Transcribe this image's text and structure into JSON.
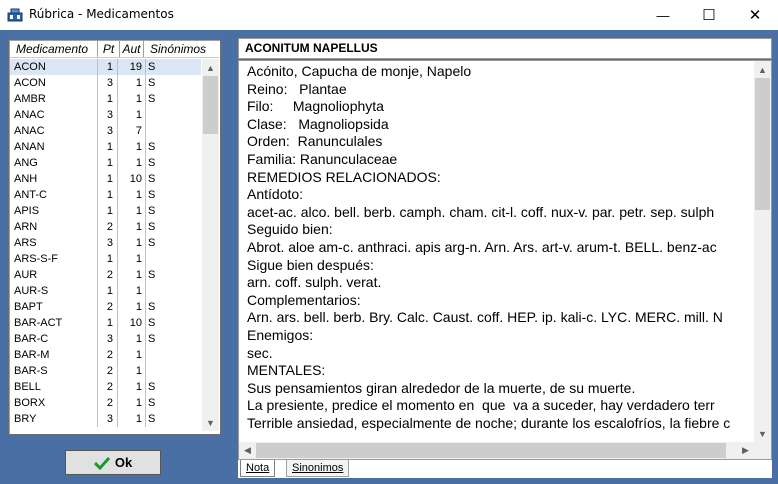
{
  "window": {
    "title": "Rúbrica - Medicamentos",
    "minimize_glyph": "—",
    "maximize_glyph": "☐",
    "close_glyph": "✕"
  },
  "list": {
    "headers": {
      "medicamento": "Medicamento",
      "pt": "Pt",
      "aut": "Aut",
      "sinonimos": "Sinónimos"
    },
    "rows": [
      {
        "med": "ACON",
        "pt": "1",
        "aut": "19",
        "sin": "S"
      },
      {
        "med": "ACON",
        "pt": "3",
        "aut": "1",
        "sin": "S"
      },
      {
        "med": "AMBR",
        "pt": "1",
        "aut": "1",
        "sin": "S"
      },
      {
        "med": "ANAC",
        "pt": "3",
        "aut": "1",
        "sin": ""
      },
      {
        "med": "ANAC",
        "pt": "3",
        "aut": "7",
        "sin": ""
      },
      {
        "med": "ANAN",
        "pt": "1",
        "aut": "1",
        "sin": "S"
      },
      {
        "med": "ANG",
        "pt": "1",
        "aut": "1",
        "sin": "S"
      },
      {
        "med": "ANH",
        "pt": "1",
        "aut": "10",
        "sin": "S"
      },
      {
        "med": "ANT-C",
        "pt": "1",
        "aut": "1",
        "sin": "S"
      },
      {
        "med": "APIS",
        "pt": "1",
        "aut": "1",
        "sin": "S"
      },
      {
        "med": "ARN",
        "pt": "2",
        "aut": "1",
        "sin": "S"
      },
      {
        "med": "ARS",
        "pt": "3",
        "aut": "1",
        "sin": "S"
      },
      {
        "med": "ARS-S-F",
        "pt": "1",
        "aut": "1",
        "sin": ""
      },
      {
        "med": "AUR",
        "pt": "2",
        "aut": "1",
        "sin": "S"
      },
      {
        "med": "AUR-S",
        "pt": "1",
        "aut": "1",
        "sin": ""
      },
      {
        "med": "BAPT",
        "pt": "2",
        "aut": "1",
        "sin": "S"
      },
      {
        "med": "BAR-ACT",
        "pt": "1",
        "aut": "10",
        "sin": "S"
      },
      {
        "med": "BAR-C",
        "pt": "3",
        "aut": "1",
        "sin": "S"
      },
      {
        "med": "BAR-M",
        "pt": "2",
        "aut": "1",
        "sin": ""
      },
      {
        "med": "BAR-S",
        "pt": "2",
        "aut": "1",
        "sin": ""
      },
      {
        "med": "BELL",
        "pt": "2",
        "aut": "1",
        "sin": "S"
      },
      {
        "med": "BORX",
        "pt": "2",
        "aut": "1",
        "sin": "S"
      },
      {
        "med": "BRY",
        "pt": "3",
        "aut": "1",
        "sin": "S"
      }
    ],
    "selected_index": 0
  },
  "ok_button": {
    "label": "Ok"
  },
  "detail": {
    "title": "ACONITUM NAPELLUS",
    "lines": [
      "Acónito, Capucha de monje, Napelo",
      "Reino:   Plantae",
      "Filo:     Magnoliophyta",
      "Clase:   Magnoliopsida",
      "Orden:  Ranunculales",
      "Familia: Ranunculaceae",
      "REMEDIOS RELACIONADOS:",
      "Antídoto:",
      "acet-ac. alco. bell. berb. camph. cham. cit-l. coff. nux-v. par. petr. sep. sulph",
      "Seguido bien:",
      "Abrot. aloe am-c. anthraci. apis arg-n. Arn. Ars. art-v. arum-t. BELL. benz-ac",
      "Sigue bien después:",
      "arn. coff. sulph. verat.",
      "Complementarios:",
      "Arn. ars. bell. berb. Bry. Calc. Caust. coff. HEP. ip. kali-c. LYC. MERC. mill. N",
      "Enemigos:",
      "sec.",
      "MENTALES:",
      "Sus pensamientos giran alrededor de la muerte, de su muerte.",
      "La presiente, predice el momento en  que  va a suceder, hay verdadero terr",
      "Terrible ansiedad, especialmente de noche; durante los escalofríos, la fiebre c"
    ]
  },
  "tabs": {
    "nota": "Nota",
    "sinonimos": "Sinonimos"
  },
  "icons": {
    "app": "pharmacy-icon",
    "ok": "checkmark-icon"
  },
  "colors": {
    "background": "#4a6fa5",
    "selection": "#dbe6f4",
    "ok_check": "#1a9a2a"
  }
}
